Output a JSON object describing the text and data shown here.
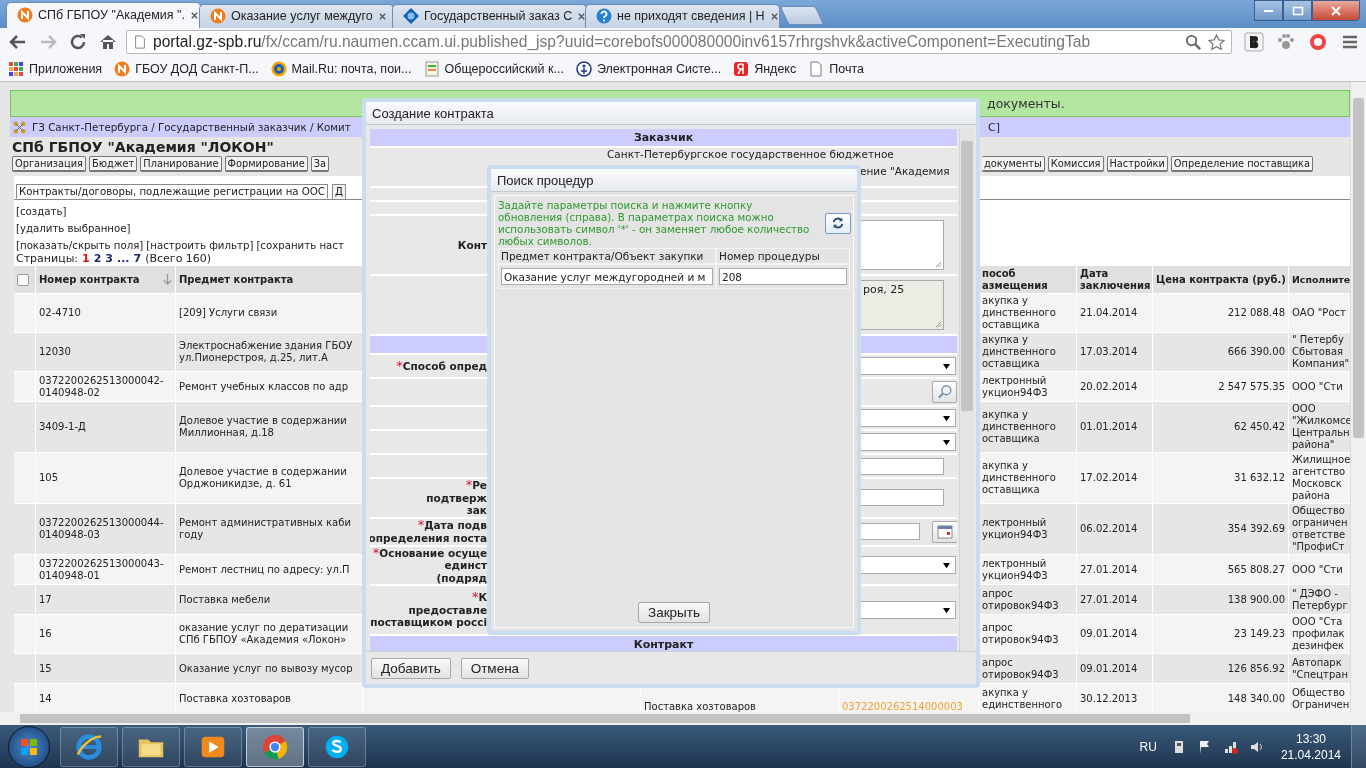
{
  "browser": {
    "tabs": [
      {
        "title": "СПб ГБПОУ \"Академия \".",
        "kind": "naumen",
        "selected": true
      },
      {
        "title": "Оказание услуг междуго",
        "kind": "naumen",
        "selected": false
      },
      {
        "title": "Государственный заказ С",
        "kind": "globe",
        "selected": false
      },
      {
        "title": "не приходят сведения | Н",
        "kind": "help",
        "selected": false
      }
    ],
    "url_host": "portal.gz-spb.ru",
    "url_path": "/fx/ccam/ru.naumen.ccam.ui.published_jsp?uuid=corebofs000080000inv6157rhrgshvk&activeComponent=ExecutingTab",
    "bookmarks": [
      {
        "label": "Приложения",
        "kind": "apps"
      },
      {
        "label": "ГБОУ ДОД Санкт-П...",
        "kind": "naumen"
      },
      {
        "label": "Mail.Ru: почта, пои...",
        "kind": "mail"
      },
      {
        "label": "Общероссийский к...",
        "kind": "doc"
      },
      {
        "label": "Электронная Систе...",
        "kind": "emblem"
      },
      {
        "label": "Яндекс",
        "kind": "yandex"
      },
      {
        "label": "Почта",
        "kind": "page"
      }
    ]
  },
  "page": {
    "notice_tail": "документы.",
    "breadcrumb": "ГЗ Санкт-Петербурга / Государственный заказчик / Комит",
    "breadcrumb_tail": "С]",
    "org_title": "СПб ГБПОУ \"Академия \"ЛОКОН\"",
    "tabs_left": [
      "Организация",
      "Бюджет",
      "Планирование",
      "Формирование",
      "За"
    ],
    "tabs_right": [
      "документы",
      "Комиссия",
      "Настройки",
      "Определение поставщика"
    ],
    "subtabs": [
      {
        "label": "Контракты/договоры, подлежащие регистрации на ООС",
        "selected": true
      },
      {
        "label": "Д",
        "selected": false
      }
    ],
    "actions": [
      "[создать]",
      "[удалить выбранное]"
    ],
    "links": [
      "[показать/скрыть поля]",
      "[настроить фильтр]",
      "[сохранить наст"
    ],
    "pager": {
      "label": "Страницы:",
      "pages": [
        {
          "label": "1",
          "selected": true
        },
        {
          "label": "2",
          "selected": false
        },
        {
          "label": "3",
          "selected": false
        },
        {
          "label": "...",
          "selected": false
        },
        {
          "label": "7",
          "selected": false
        }
      ],
      "total": "(Всего 160)"
    },
    "table": {
      "select_all": {
        "checked": false
      },
      "columns": [
        "Номер контракта",
        "Предмет контракта",
        "пособ\nазмещения",
        "Дата\nзаключения",
        "Цена контракта (руб.)",
        "Исполните"
      ],
      "rows": [
        {
          "number": "02-4710",
          "subject": "[209] Услуги связи",
          "method": "акупка у\nдинственного\nоставщика",
          "date": "21.04.2014",
          "price": "212 088.48",
          "executor": "ОАО \"Рост"
        },
        {
          "number": "12030",
          "subject": "Электроснабжение здания ГБОУ\nул.Пионерстроя, д.25, лит.А",
          "method": "акупка у\nдинственного\nоставщика",
          "date": "17.03.2014",
          "price": "666 390.00",
          "executor": "\" Петербу\nСбытовая\nКомпания\""
        },
        {
          "number": "0372200262513000042-\n0140948-02",
          "subject": "Ремонт учебных классов по адр",
          "method": "лектронный\nукцион94Ф3",
          "date": "20.02.2014",
          "price": "2 547 575.35",
          "executor": "ООО \"Сти"
        },
        {
          "number": "3409-1-Д",
          "subject": "Долевое участие в содержании\nМиллионная, д.18",
          "method": "акупка у\nдинственного\nоставщика",
          "date": "01.01.2014",
          "price": "62 450.42",
          "executor": "ООО\n\"Жилкомсе\nЦентральн\nрайона\""
        },
        {
          "number": "105",
          "subject": "Долевое участие в содержании\nОрджоникидзе, д. 61",
          "method": "акупка у\nдинственного\nоставщика",
          "date": "17.02.2014",
          "price": "31 632.12",
          "executor": "Жилищное\nагентство\nМосковск\nрайона"
        },
        {
          "number": "0372200262513000044-\n0140948-03",
          "subject": "Ремонт административных каби\nгоду",
          "method": "лектронный\nукцион94Ф3",
          "date": "06.02.2014",
          "price": "354 392.69",
          "executor": "Общество\nограничен\nответстве\n\"ПрофиСт"
        },
        {
          "number": "0372200262513000043-\n0140948-01",
          "subject": "Ремонт лестниц по адресу: ул.П",
          "method": "лектронный\nукцион94Ф3",
          "date": "27.01.2014",
          "price": "565 808.27",
          "executor": "ООО \"Сти"
        },
        {
          "number": "17",
          "subject": "Поставка мебели",
          "method": "апрос\nотировок94Ф3",
          "date": "27.01.2014",
          "price": "138 900.00",
          "executor": "\" ДЭФО -\nПетербург"
        },
        {
          "number": "16",
          "subject": "оказание услуг по дератизации\nСПб ГБПОУ «Академия «Локон»",
          "method": "апрос\nотировок94Ф3",
          "date": "09.01.2014",
          "price": "23 149.23",
          "executor": "ООО \"Ста\nпрофилак\nдезинфек"
        },
        {
          "number": "15",
          "subject": "Оказание услуг по вывозу мусор",
          "method": "апрос\nотировок94Ф3",
          "date": "09.01.2014",
          "price": "126 856.92",
          "executor": "Автопарк\n\"Спецтран"
        },
        {
          "number": "14",
          "subject": "Поставка хозтоваров",
          "name": "Поставка хозтоваров",
          "notice": "0372200262514000003",
          "method": "акупка у\nединственного",
          "date": "30.12.2013",
          "price": "148 340.00",
          "executor": "Общество\nОграничен"
        }
      ]
    }
  },
  "contract_dialog": {
    "title": "Создание контракта",
    "customer": {
      "section": "Заказчик",
      "line1": "Санкт-Петербургское государственное бюджетное",
      "line2": "ение \"Академия"
    },
    "fields": [
      {
        "kind": "textarea",
        "label": "Конт",
        "disabled": false
      },
      {
        "kind": "textarea",
        "value": "роя, 25",
        "disabled": true
      },
      {
        "kind": "section"
      },
      {
        "kind": "select",
        "mark": "*",
        "label": "Способ опред"
      },
      {
        "kind": "lookup"
      },
      {
        "kind": "select"
      },
      {
        "kind": "select"
      },
      {
        "kind": "input"
      },
      {
        "kind": "input",
        "mark": "*",
        "label": "Ре\nподтверж\nзак"
      },
      {
        "kind": "date",
        "mark": "*",
        "label": "Дата подв\nопределения поста"
      },
      {
        "kind": "select",
        "mark": "*",
        "label": "Основание осуще\nединст\n(подряд"
      },
      {
        "kind": "select",
        "mark": "*",
        "label": "К\nпредоставле\nпоставщиком россі"
      },
      {
        "kind": "section",
        "label": "Контракт"
      }
    ],
    "buttons": [
      "Добавить",
      "Отмена"
    ]
  },
  "search_dialog": {
    "title": "Поиск процедур",
    "hint": "Задайте параметры поиска и нажмите кнопку обновления (справа). В параметрах поиска можно использовать символ '*' - он заменяет любое количество любых символов.",
    "columns": [
      "Предмет контракта/Объект закупки",
      "Номер процедуры"
    ],
    "values": [
      "Оказание услуг междугородней и м",
      "208"
    ],
    "close": "Закрыть"
  },
  "taskbar": {
    "apps": [
      {
        "kind": "ie",
        "selected": false
      },
      {
        "kind": "folder",
        "selected": false
      },
      {
        "kind": "media",
        "selected": false
      },
      {
        "kind": "chrome",
        "selected": true
      },
      {
        "kind": "skype",
        "selected": false
      }
    ],
    "lang": "RU",
    "time": "13:30",
    "date": "21.04.2014"
  }
}
